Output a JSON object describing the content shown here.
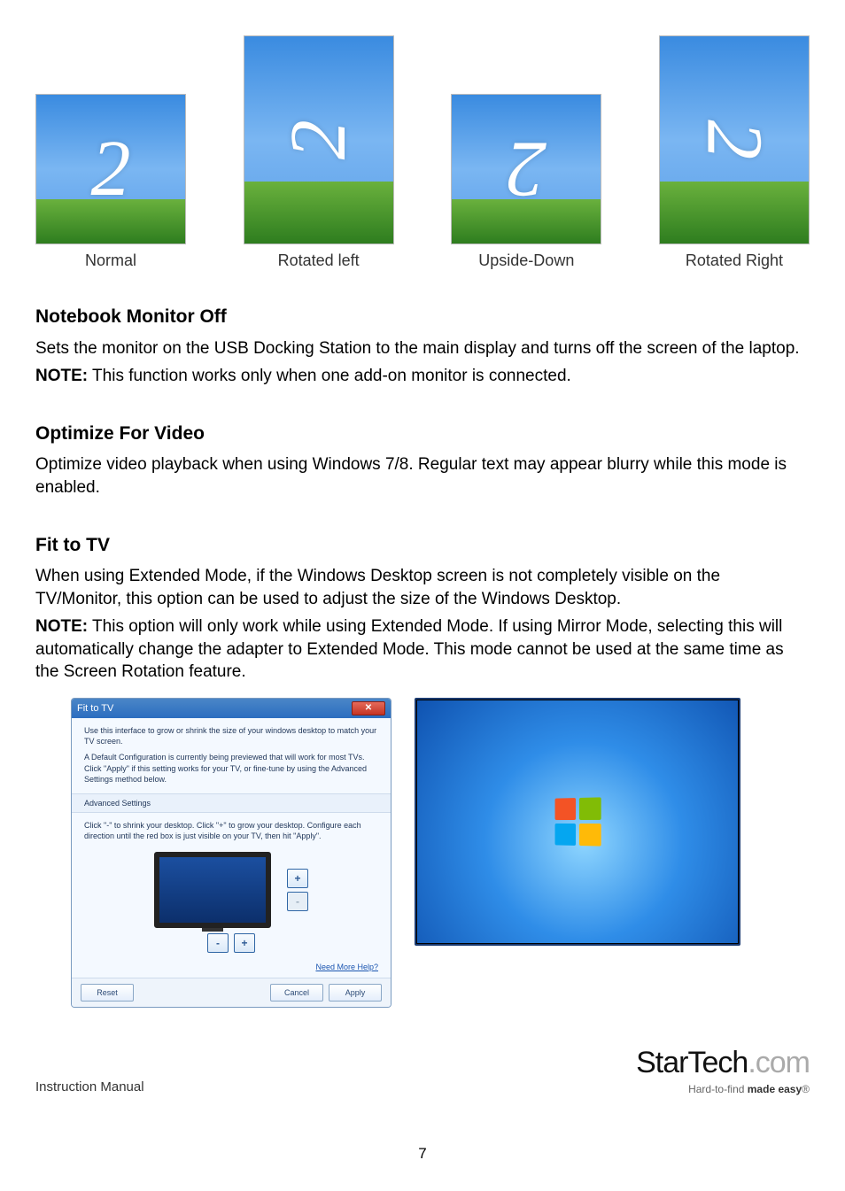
{
  "thumbs": [
    {
      "glyph": "2",
      "caption": "Normal"
    },
    {
      "glyph": "2",
      "caption": "Rotated left"
    },
    {
      "glyph": "2",
      "caption": "Upside-Down"
    },
    {
      "glyph": "2",
      "caption": "Rotated Right"
    }
  ],
  "section1": {
    "heading": "Notebook Monitor Off",
    "body": "Sets the monitor on the USB Docking Station to the main display and turns off the screen of the laptop.",
    "note_label": "NOTE:",
    "note_body": " This function works only when one add-on monitor is connected."
  },
  "section2": {
    "heading": "Optimize For Video",
    "body": "Optimize video playback when using Windows 7/8.  Regular text may appear blurry while this mode is enabled."
  },
  "section3": {
    "heading": "Fit to TV",
    "body1": "When using Extended Mode, if the Windows Desktop screen is not completely visible on the TV/Monitor, this option can be used to adjust the size of the Windows Desktop.",
    "note_label": "NOTE:",
    "note_body": " This option will only work while using Extended Mode.  If using Mirror Mode, selecting this will automatically change the adapter to Extended Mode.  This mode cannot be used at the same time as the Screen Rotation feature."
  },
  "dialog": {
    "title": "Fit to TV",
    "p1": "Use this interface to grow or shrink the size of your windows desktop to match your TV screen.",
    "p2": "A Default Configuration is currently being previewed that will work for most TVs. Click \"Apply\" if this setting works for your TV, or fine-tune by using the Advanced Settings method below.",
    "adv_hdr": "Advanced Settings",
    "adv_body": "Click \"-\" to shrink your desktop. Click \"+\" to grow your desktop. Configure each direction until the red box is just visible on your TV, then hit \"Apply\".",
    "plus": "+",
    "minus": "-",
    "help_link": "Need More Help?",
    "btn_reset": "Reset",
    "btn_cancel": "Cancel",
    "btn_apply": "Apply"
  },
  "footer": {
    "left": "Instruction Manual",
    "page": "7",
    "brand_dark": "StarTech",
    "brand_light": ".com",
    "tag_pre": "Hard-to-find ",
    "tag_bold": "made easy",
    "tag_suffix": "®"
  }
}
